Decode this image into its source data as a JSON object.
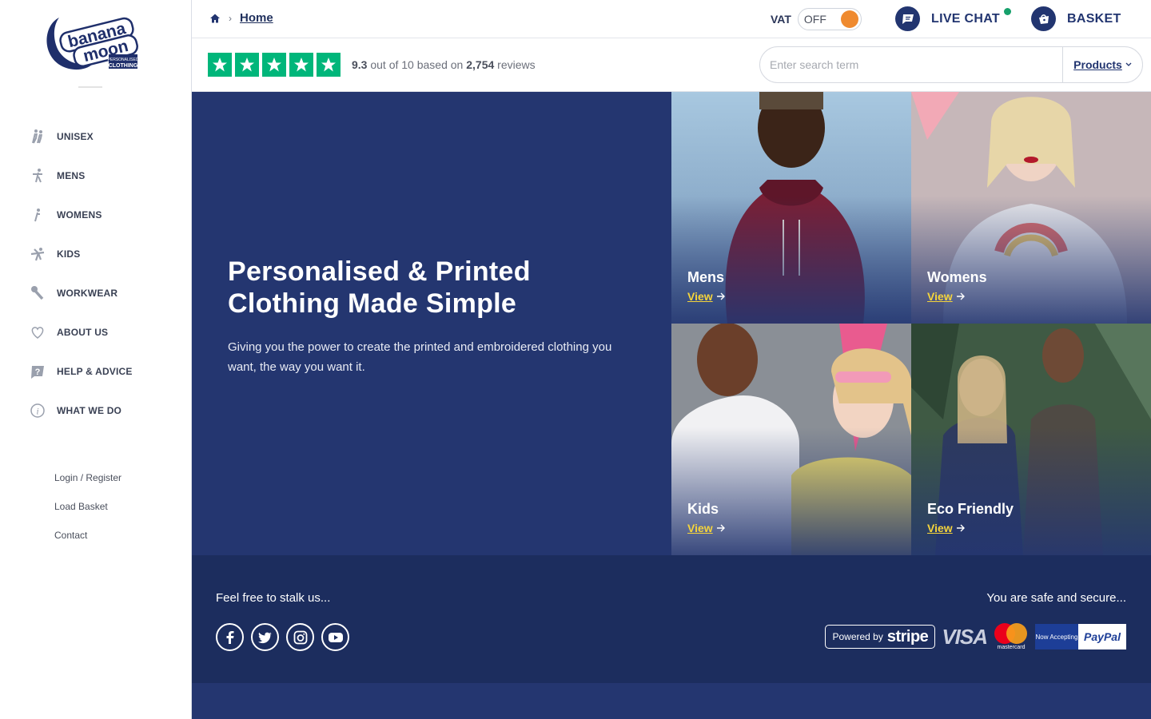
{
  "brand": {
    "logo_line1": "banana",
    "logo_line2": "moon",
    "logo_tag1": "PERSONALISED",
    "logo_tag2": "CLOTHING",
    "colors": {
      "navy": "#243670",
      "footer": "#1c2d5e",
      "accent_yellow": "#f5d43b",
      "vat_orange": "#ef8a2f",
      "trust_green": "#00b67a"
    }
  },
  "sidebar": {
    "items": [
      {
        "label": "UNISEX",
        "icon": "unisex-icon"
      },
      {
        "label": "MENS",
        "icon": "mens-icon"
      },
      {
        "label": "WOMENS",
        "icon": "womens-icon"
      },
      {
        "label": "KIDS",
        "icon": "kids-icon"
      },
      {
        "label": "WORKWEAR",
        "icon": "workwear-icon"
      },
      {
        "label": "ABOUT US",
        "icon": "heart-icon"
      },
      {
        "label": "HELP & ADVICE",
        "icon": "help-icon"
      },
      {
        "label": "WHAT WE DO",
        "icon": "info-icon"
      }
    ],
    "links": [
      "Login / Register",
      "Load Basket",
      "Contact"
    ]
  },
  "topbar": {
    "breadcrumb": "Home",
    "breadcrumb_sep": "›",
    "vat_label": "VAT",
    "vat_state": "OFF",
    "live_chat": "LIVE CHAT",
    "basket": "BASKET"
  },
  "reviews": {
    "score": "9.3",
    "text_mid": " out of 10 based on ",
    "count": "2,754",
    "text_end": " reviews",
    "stars": 5
  },
  "search": {
    "placeholder": "Enter search term",
    "dropdown": "Products"
  },
  "hero": {
    "title": "Personalised & Printed Clothing Made Simple",
    "subtitle": "Giving you the power to create the printed and embroidered clothing you want, the way you want it."
  },
  "tiles": [
    {
      "name": "Mens",
      "cta": "View"
    },
    {
      "name": "Womens",
      "cta": "View"
    },
    {
      "name": "Kids",
      "cta": "View"
    },
    {
      "name": "Eco Friendly",
      "cta": "View"
    }
  ],
  "footer": {
    "stalk": "Feel free to stalk us...",
    "safe": "You are safe and secure...",
    "stripe_powered": "Powered by",
    "stripe_brand": "stripe",
    "visa": "VISA",
    "mastercard": "mastercard",
    "paypal_now": "Now Accepting",
    "paypal": "PayPal"
  }
}
